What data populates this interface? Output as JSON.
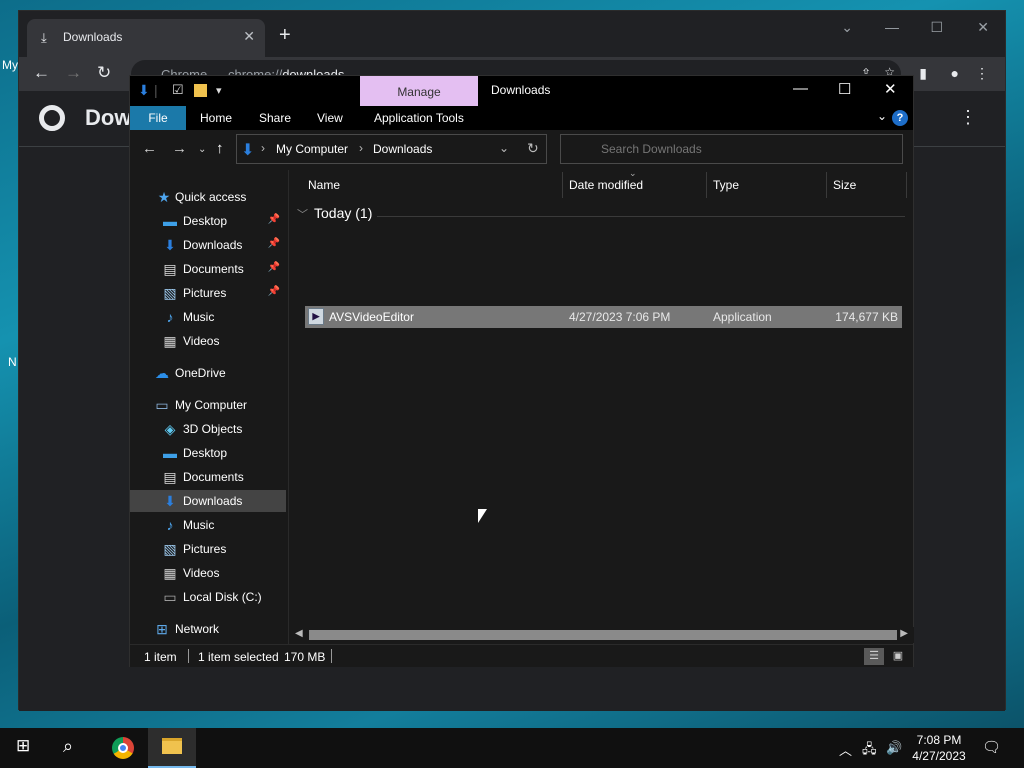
{
  "desktop": {
    "label_1": "My",
    "label_2": "N"
  },
  "chrome": {
    "tab_title": "Downloads",
    "tab_icon": "download-icon",
    "omnibox_site": "Chrome",
    "omnibox_url_prefix": "chrome://",
    "omnibox_url_path": "downloads",
    "page_title": "Dow"
  },
  "explorer": {
    "window_title": "Downloads",
    "contextual_tab": "Manage",
    "ribbon_tabs": [
      "File",
      "Home",
      "Share",
      "View",
      "Application Tools"
    ],
    "address": {
      "crumbs": [
        "My Computer",
        "Downloads"
      ]
    },
    "search_placeholder": "Search Downloads",
    "sidebar": [
      {
        "label": "Quick access",
        "icon": "star-icon",
        "pinned": false
      },
      {
        "label": "Desktop",
        "icon": "desktop-icon",
        "pinned": true
      },
      {
        "label": "Downloads",
        "icon": "download-icon",
        "pinned": true
      },
      {
        "label": "Documents",
        "icon": "document-icon",
        "pinned": true
      },
      {
        "label": "Pictures",
        "icon": "pictures-icon",
        "pinned": true
      },
      {
        "label": "Music",
        "icon": "music-icon",
        "pinned": false
      },
      {
        "label": "Videos",
        "icon": "video-icon",
        "pinned": false
      },
      {
        "label": "OneDrive",
        "icon": "cloud-icon",
        "pinned": false
      },
      {
        "label": "My Computer",
        "icon": "computer-icon",
        "pinned": false
      },
      {
        "label": "3D Objects",
        "icon": "cube-icon",
        "pinned": false
      },
      {
        "label": "Desktop",
        "icon": "desktop-icon",
        "pinned": false
      },
      {
        "label": "Documents",
        "icon": "document-icon",
        "pinned": false
      },
      {
        "label": "Downloads",
        "icon": "download-icon",
        "pinned": false,
        "selected": true
      },
      {
        "label": "Music",
        "icon": "music-icon",
        "pinned": false
      },
      {
        "label": "Pictures",
        "icon": "pictures-icon",
        "pinned": false
      },
      {
        "label": "Videos",
        "icon": "video-icon",
        "pinned": false
      },
      {
        "label": "Local Disk (C:)",
        "icon": "drive-icon",
        "pinned": false
      },
      {
        "label": "Network",
        "icon": "network-icon",
        "pinned": false
      }
    ],
    "columns": [
      "Name",
      "Date modified",
      "Type",
      "Size"
    ],
    "group_label": "Today (1)",
    "files": [
      {
        "name": "AVSVideoEditor",
        "date": "4/27/2023 7:06 PM",
        "type": "Application",
        "size": "174,677 KB",
        "selected": true
      }
    ],
    "status": {
      "items": "1 item",
      "selected": "1 item selected",
      "size": "170 MB"
    }
  },
  "taskbar": {
    "time": "7:08 PM",
    "date": "4/27/2023"
  },
  "colors": {
    "file_tab": "#1b79a9",
    "manage_tab": "#e4bff2",
    "selection": "#777777"
  }
}
